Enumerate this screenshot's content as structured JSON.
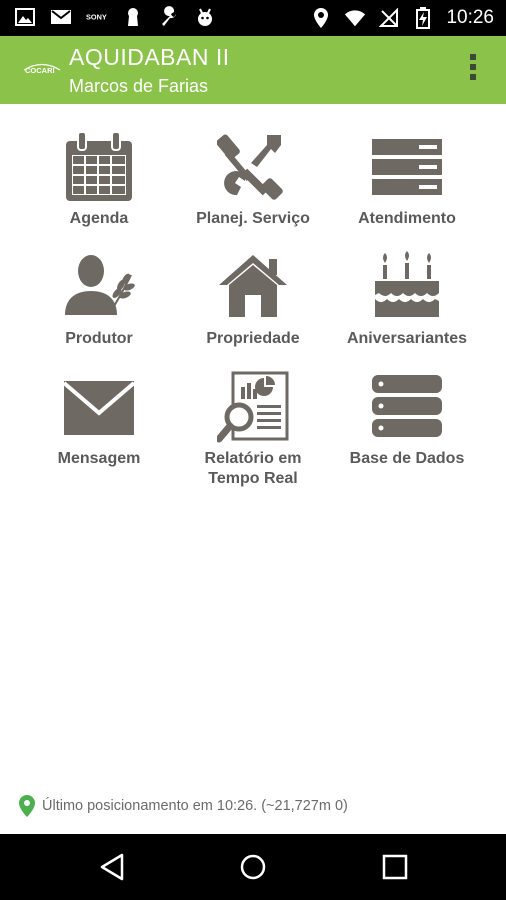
{
  "status_bar": {
    "time": "10:26",
    "left_icons": [
      "image-icon",
      "gmail-icon",
      "sony-icon",
      "keyhole-icon",
      "wrench-icon",
      "android-icon"
    ],
    "right_icons": [
      "location-icon",
      "wifi-icon",
      "no-signal-icon",
      "battery-charging-icon"
    ]
  },
  "app_bar": {
    "logo_text": "COCARI",
    "title": "AQUIDABAN II",
    "subtitle": "Marcos de Farias",
    "menu_icon": "overflow-menu-icon"
  },
  "tiles": [
    {
      "id": "agenda",
      "label": "Agenda",
      "icon": "calendar-icon"
    },
    {
      "id": "planej-servico",
      "label": "Planej. Serviço",
      "icon": "tools-icon"
    },
    {
      "id": "atendimento",
      "label": "Atendimento",
      "icon": "list-icon"
    },
    {
      "id": "produtor",
      "label": "Produtor",
      "icon": "farmer-icon"
    },
    {
      "id": "propriedade",
      "label": "Propriedade",
      "icon": "house-icon"
    },
    {
      "id": "aniversariantes",
      "label": "Aniversariantes",
      "icon": "cake-icon"
    },
    {
      "id": "mensagem",
      "label": "Mensagem",
      "icon": "envelope-icon"
    },
    {
      "id": "relatorio",
      "label": "Relatório em\nTempo Real",
      "icon": "report-icon"
    },
    {
      "id": "base-dados",
      "label": "Base de Dados",
      "icon": "database-icon"
    }
  ],
  "position_info": {
    "text": "Último posicionamento em 10:26. (~21,727m 0)",
    "icon": "map-pin-icon",
    "pin_color": "#4caf50"
  },
  "nav_bar": {
    "buttons": [
      "back-icon",
      "home-icon",
      "recents-icon"
    ]
  },
  "colors": {
    "accent": "#8bc34a",
    "icon_gray": "#6e6963"
  }
}
